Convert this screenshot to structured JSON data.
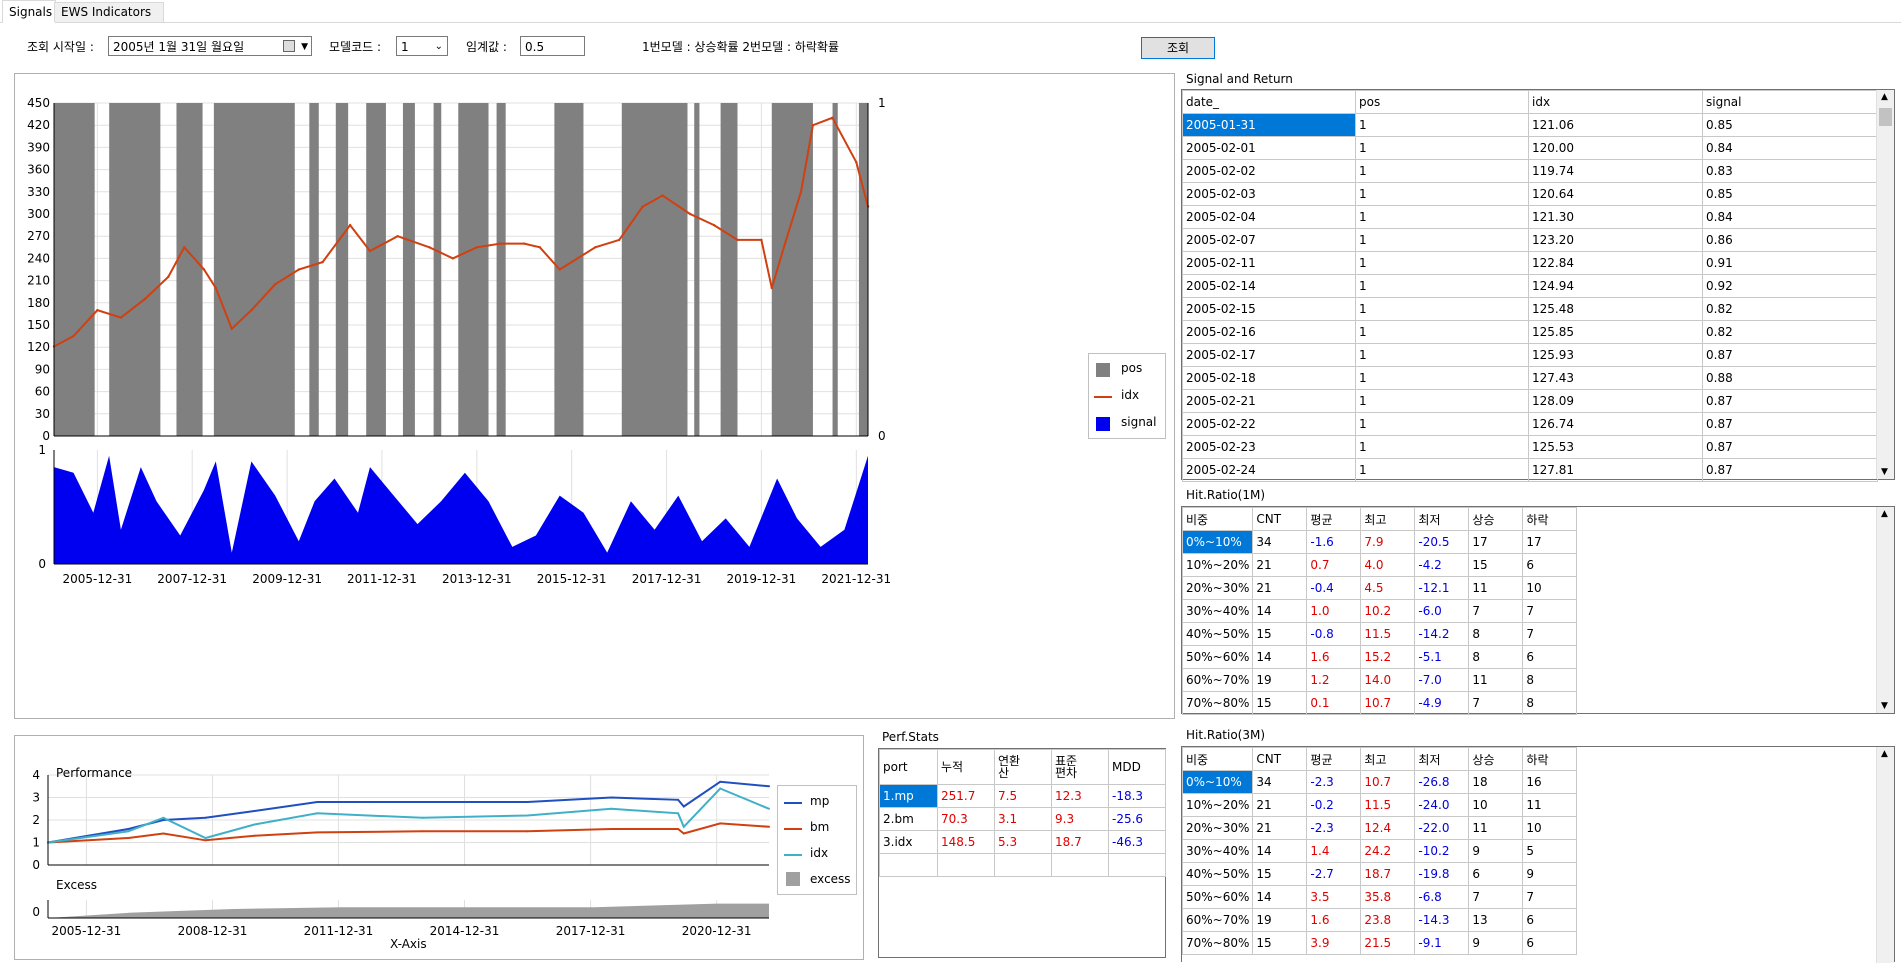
{
  "tabs": [
    "Signals",
    "EWS Indicators"
  ],
  "toolbar": {
    "start_label": "조회 시작일 :",
    "start_value": "2005년   1월 31일 월요일",
    "model_label": "모델코드 :",
    "model_value": "1",
    "threshold_label": "임계값 :",
    "threshold_value": "0.5",
    "note": "1번모델 : 상승확률 2번모델 : 하락확률",
    "query_button": "조회"
  },
  "colors": {
    "pos": "#808080",
    "idx": "#d04010",
    "signal": "#0000f0",
    "mp": "#2050c0",
    "bm": "#d04010",
    "idx_perf": "#40b0c8",
    "excess": "#a0a0a0",
    "accent": "#0078d7"
  },
  "chart_data": [
    {
      "type": "line",
      "name": "main-signal-chart",
      "legend": [
        "pos",
        "idx",
        "signal"
      ],
      "y_left_ticks": [
        "450",
        "420",
        "390",
        "360",
        "330",
        "300",
        "270",
        "240",
        "210",
        "180",
        "150",
        "120",
        "90",
        "60",
        "30",
        "0"
      ],
      "y_right_ticks": [
        "1",
        "0"
      ],
      "ylim": [
        0,
        450
      ],
      "x_ticks": [
        "2005-12-31",
        "2007-12-31",
        "2009-12-31",
        "2011-12-31",
        "2013-12-31",
        "2015-12-31",
        "2017-12-31",
        "2019-12-31",
        "2021-12-31"
      ],
      "xlim": [
        "2005-01-31",
        "2022-03-31"
      ],
      "idx_series": {
        "x": [
          "2005-01-31",
          "2005-06-30",
          "2005-12-31",
          "2006-06-30",
          "2006-12-31",
          "2007-06-30",
          "2007-10-31",
          "2008-03-31",
          "2008-06-30",
          "2008-10-31",
          "2009-03-31",
          "2009-09-30",
          "2010-03-31",
          "2010-09-30",
          "2011-04-30",
          "2011-09-30",
          "2012-04-30",
          "2012-12-31",
          "2013-06-30",
          "2013-12-31",
          "2014-06-30",
          "2014-12-31",
          "2015-04-30",
          "2015-09-30",
          "2016-06-30",
          "2016-12-31",
          "2017-06-30",
          "2017-11-30",
          "2018-06-30",
          "2018-12-31",
          "2019-06-30",
          "2019-12-31",
          "2020-03-20",
          "2020-06-30",
          "2020-10-31",
          "2021-01-31",
          "2021-06-30",
          "2021-12-31",
          "2022-03-31"
        ],
        "y": [
          121,
          135,
          170,
          160,
          185,
          215,
          255,
          225,
          200,
          145,
          170,
          205,
          225,
          235,
          285,
          250,
          270,
          255,
          240,
          255,
          260,
          260,
          255,
          225,
          255,
          265,
          310,
          325,
          300,
          285,
          265,
          265,
          200,
          260,
          330,
          420,
          430,
          370,
          310
        ]
      },
      "pos_periods": [
        [
          "2005-01-31",
          "2005-12-10"
        ],
        [
          "2006-04-01",
          "2007-04-30"
        ],
        [
          "2007-09-01",
          "2008-03-20"
        ],
        [
          "2008-06-15",
          "2010-02-28"
        ],
        [
          "2010-06-20",
          "2010-09-01"
        ],
        [
          "2011-01-10",
          "2011-04-15"
        ],
        [
          "2011-09-01",
          "2012-01-31"
        ],
        [
          "2012-06-10",
          "2012-09-10"
        ],
        [
          "2013-02-01",
          "2013-04-01"
        ],
        [
          "2013-08-10",
          "2014-03-31"
        ],
        [
          "2014-06-01",
          "2014-08-10"
        ],
        [
          "2015-08-20",
          "2016-03-31"
        ],
        [
          "2017-01-20",
          "2018-06-10"
        ],
        [
          "2018-08-01",
          "2018-09-10"
        ],
        [
          "2019-02-20",
          "2019-06-30"
        ],
        [
          "2020-03-20",
          "2021-01-31"
        ],
        [
          "2021-07-01",
          "2021-08-10"
        ],
        [
          "2022-01-20",
          "2022-03-31"
        ]
      ]
    },
    {
      "type": "area",
      "name": "signal-area-chart",
      "y_ticks": [
        "1",
        "0"
      ],
      "ylim": [
        0,
        1
      ],
      "series": {
        "name": "signal",
        "x": [
          "2005-01-31",
          "2005-06-30",
          "2005-11-30",
          "2006-03-31",
          "2006-06-30",
          "2006-11-30",
          "2007-03-31",
          "2007-09-30",
          "2008-03-31",
          "2008-06-30",
          "2008-10-31",
          "2009-03-31",
          "2009-09-30",
          "2010-03-31",
          "2010-07-31",
          "2010-12-31",
          "2011-06-30",
          "2011-09-30",
          "2012-03-31",
          "2012-09-30",
          "2013-03-31",
          "2013-09-30",
          "2014-03-31",
          "2014-09-30",
          "2015-03-31",
          "2015-09-30",
          "2016-03-31",
          "2016-09-30",
          "2017-03-31",
          "2017-09-30",
          "2018-03-31",
          "2018-09-30",
          "2019-03-31",
          "2019-09-30",
          "2020-04-30",
          "2020-09-30",
          "2021-03-31",
          "2021-09-30",
          "2022-03-31"
        ],
        "y": [
          0.85,
          0.8,
          0.45,
          0.95,
          0.3,
          0.85,
          0.55,
          0.25,
          0.65,
          0.9,
          0.1,
          0.9,
          0.6,
          0.2,
          0.55,
          0.75,
          0.45,
          0.85,
          0.6,
          0.35,
          0.55,
          0.8,
          0.55,
          0.15,
          0.25,
          0.6,
          0.45,
          0.1,
          0.55,
          0.3,
          0.6,
          0.2,
          0.4,
          0.15,
          0.75,
          0.4,
          0.15,
          0.3,
          0.95
        ]
      }
    },
    {
      "type": "line",
      "name": "performance-chart",
      "title": "Performance",
      "legend": [
        "mp",
        "bm",
        "idx",
        "excess"
      ],
      "y_ticks": [
        "4",
        "3",
        "2",
        "1",
        "0"
      ],
      "ylim": [
        0,
        4
      ],
      "x_ticks": [
        "2005-12-31",
        "2008-12-31",
        "2011-12-31",
        "2014-12-31",
        "2017-12-31",
        "2020-12-31"
      ],
      "xlabel": "X-Axis",
      "xlim": [
        "2005-01-31",
        "2022-03-31"
      ],
      "series": [
        {
          "name": "mp",
          "x": [
            "2005-01-31",
            "2006-12-31",
            "2007-10-31",
            "2008-10-31",
            "2009-12-31",
            "2011-06-30",
            "2013-12-31",
            "2016-06-30",
            "2018-06-30",
            "2020-01-31",
            "2020-03-20",
            "2021-01-31",
            "2022-03-31"
          ],
          "y": [
            1.0,
            1.6,
            2.0,
            2.1,
            2.4,
            2.8,
            2.8,
            2.8,
            3.0,
            2.9,
            2.6,
            3.7,
            3.5
          ]
        },
        {
          "name": "bm",
          "x": [
            "2005-01-31",
            "2006-12-31",
            "2007-10-31",
            "2008-10-31",
            "2009-12-31",
            "2011-06-30",
            "2013-12-31",
            "2016-06-30",
            "2018-06-30",
            "2020-01-31",
            "2020-03-20",
            "2021-01-31",
            "2022-03-31"
          ],
          "y": [
            1.0,
            1.2,
            1.4,
            1.1,
            1.3,
            1.45,
            1.5,
            1.5,
            1.6,
            1.6,
            1.4,
            1.85,
            1.7
          ]
        },
        {
          "name": "idx",
          "x": [
            "2005-01-31",
            "2006-12-31",
            "2007-10-31",
            "2008-10-31",
            "2009-12-31",
            "2011-06-30",
            "2013-12-31",
            "2016-06-30",
            "2018-06-30",
            "2020-01-31",
            "2020-03-20",
            "2021-01-31",
            "2022-03-31"
          ],
          "y": [
            1.0,
            1.5,
            2.1,
            1.2,
            1.8,
            2.3,
            2.1,
            2.2,
            2.5,
            2.3,
            1.7,
            3.4,
            2.5
          ]
        }
      ]
    },
    {
      "type": "area",
      "name": "excess-chart",
      "title": "Excess",
      "y_ticks": [
        "0"
      ],
      "series": {
        "name": "excess",
        "x": [
          "2005-01-31",
          "2007-01-31",
          "2009-06-30",
          "2012-01-31",
          "2015-01-31",
          "2018-01-31",
          "2020-12-31",
          "2022-03-31"
        ],
        "y": [
          0.0,
          0.3,
          0.5,
          0.6,
          0.6,
          0.6,
          0.8,
          0.8
        ]
      }
    }
  ],
  "signal_table": {
    "title": "Signal and Return",
    "headers": [
      "date_",
      "pos",
      "idx",
      "signal"
    ],
    "rows": [
      [
        "2005-01-31",
        "1",
        "121.06",
        "0.85"
      ],
      [
        "2005-02-01",
        "1",
        "120.00",
        "0.84"
      ],
      [
        "2005-02-02",
        "1",
        "119.74",
        "0.83"
      ],
      [
        "2005-02-03",
        "1",
        "120.64",
        "0.85"
      ],
      [
        "2005-02-04",
        "1",
        "121.30",
        "0.84"
      ],
      [
        "2005-02-07",
        "1",
        "123.20",
        "0.86"
      ],
      [
        "2005-02-11",
        "1",
        "122.84",
        "0.91"
      ],
      [
        "2005-02-14",
        "1",
        "124.94",
        "0.92"
      ],
      [
        "2005-02-15",
        "1",
        "125.48",
        "0.82"
      ],
      [
        "2005-02-16",
        "1",
        "125.85",
        "0.82"
      ],
      [
        "2005-02-17",
        "1",
        "125.93",
        "0.87"
      ],
      [
        "2005-02-18",
        "1",
        "127.43",
        "0.88"
      ],
      [
        "2005-02-21",
        "1",
        "128.09",
        "0.87"
      ],
      [
        "2005-02-22",
        "1",
        "126.74",
        "0.87"
      ],
      [
        "2005-02-23",
        "1",
        "125.53",
        "0.87"
      ],
      [
        "2005-02-24",
        "1",
        "127.81",
        "0.87"
      ]
    ]
  },
  "hit1m": {
    "title": "Hit.Ratio(1M)",
    "headers": [
      "비중",
      "CNT",
      "평균",
      "최고",
      "최저",
      "상승",
      "하락"
    ],
    "rows": [
      [
        "0%~10%",
        "34",
        "-1.6",
        "7.9",
        "-20.5",
        "17",
        "17"
      ],
      [
        "10%~20%",
        "21",
        "0.7",
        "4.0",
        "-4.2",
        "15",
        "6"
      ],
      [
        "20%~30%",
        "21",
        "-0.4",
        "4.5",
        "-12.1",
        "11",
        "10"
      ],
      [
        "30%~40%",
        "14",
        "1.0",
        "10.2",
        "-6.0",
        "7",
        "7"
      ],
      [
        "40%~50%",
        "15",
        "-0.8",
        "11.5",
        "-14.2",
        "8",
        "7"
      ],
      [
        "50%~60%",
        "14",
        "1.6",
        "15.2",
        "-5.1",
        "8",
        "6"
      ],
      [
        "60%~70%",
        "19",
        "1.2",
        "14.0",
        "-7.0",
        "11",
        "8"
      ],
      [
        "70%~80%",
        "15",
        "0.1",
        "10.7",
        "-4.9",
        "7",
        "8"
      ]
    ]
  },
  "hit3m": {
    "title": "Hit.Ratio(3M)",
    "headers": [
      "비중",
      "CNT",
      "평균",
      "최고",
      "최저",
      "상승",
      "하락"
    ],
    "rows": [
      [
        "0%~10%",
        "34",
        "-2.3",
        "10.7",
        "-26.8",
        "18",
        "16"
      ],
      [
        "10%~20%",
        "21",
        "-0.2",
        "11.5",
        "-24.0",
        "10",
        "11"
      ],
      [
        "20%~30%",
        "21",
        "-2.3",
        "12.4",
        "-22.0",
        "11",
        "10"
      ],
      [
        "30%~40%",
        "14",
        "1.4",
        "24.2",
        "-10.2",
        "9",
        "5"
      ],
      [
        "40%~50%",
        "15",
        "-2.7",
        "18.7",
        "-19.8",
        "6",
        "9"
      ],
      [
        "50%~60%",
        "14",
        "3.5",
        "35.8",
        "-6.8",
        "7",
        "7"
      ],
      [
        "60%~70%",
        "19",
        "1.6",
        "23.8",
        "-14.3",
        "13",
        "6"
      ],
      [
        "70%~80%",
        "15",
        "3.9",
        "21.5",
        "-9.1",
        "9",
        "6"
      ]
    ]
  },
  "perf_stats": {
    "title": "Perf.Stats",
    "headers": [
      "port",
      "누적",
      "연환\n산",
      "표준\n편차",
      "MDD"
    ],
    "rows": [
      [
        "1.mp",
        "251.7",
        "7.5",
        "12.3",
        "-18.3"
      ],
      [
        "2.bm",
        "70.3",
        "3.1",
        "9.3",
        "-25.6"
      ],
      [
        "3.idx",
        "148.5",
        "5.3",
        "18.7",
        "-46.3"
      ]
    ]
  }
}
